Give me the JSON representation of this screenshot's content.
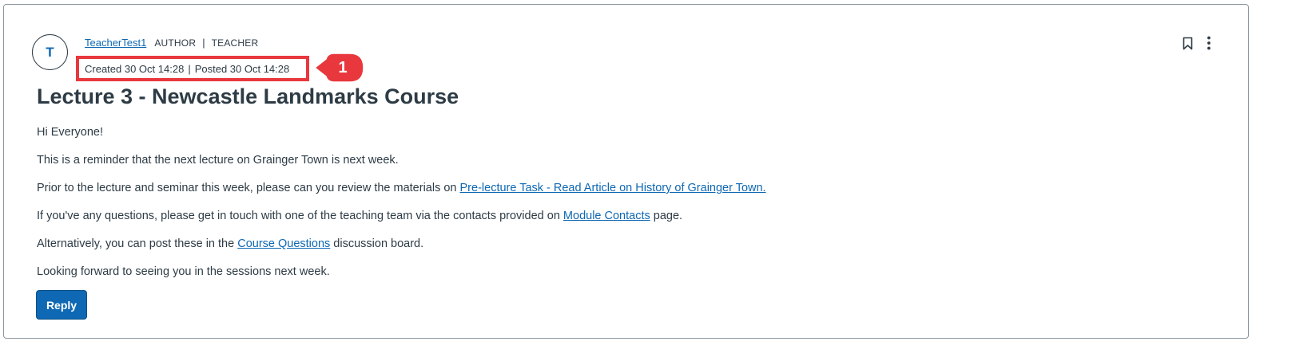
{
  "post": {
    "avatar_initial": "T",
    "author_name": "TeacherTest1",
    "role_author": "AUTHOR",
    "role_separator": "|",
    "role_teacher": "TEACHER",
    "created": "Created 30 Oct 14:28",
    "date_separator": "|",
    "posted": "Posted 30 Oct 14:28",
    "callout_number": "1",
    "title": "Lecture 3 - Newcastle Landmarks Course",
    "paragraphs": {
      "p1": "Hi Everyone!",
      "p2": "This is a reminder that the next lecture on Grainger Town is next week.",
      "p3_before": "Prior to the lecture and seminar this week, please can you review the materials on ",
      "p3_link": "Pre-lecture Task - Read Article on History of Grainger Town.",
      "p4_before": "If you've any questions, please get in touch with one of the teaching team via the contacts provided on ",
      "p4_link": "Module Contacts",
      "p4_after": " page.",
      "p5_before": "Alternatively, you can post these in the ",
      "p5_link": "Course Questions",
      "p5_after": " discussion board.",
      "p6": "Looking forward to seeing you in the sessions next week."
    },
    "reply_label": "Reply"
  },
  "icons": {
    "bookmark": "bookmark-icon",
    "more": "kebab-menu-icon"
  },
  "colors": {
    "link": "#0e68b3",
    "button": "#0e68b3",
    "highlight": "#e8383d",
    "text": "#2d3b45"
  }
}
